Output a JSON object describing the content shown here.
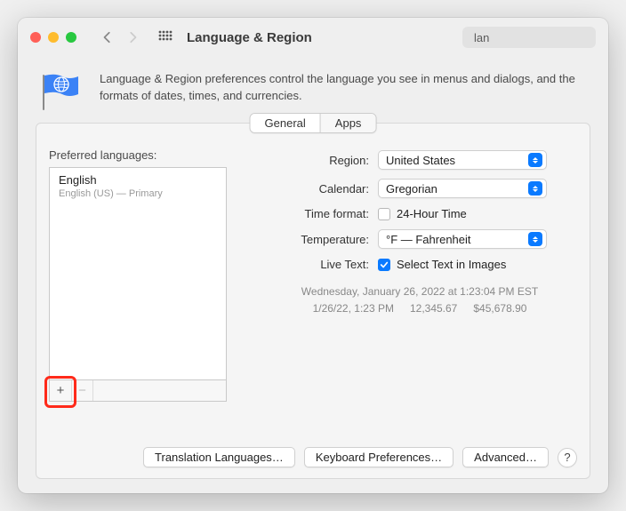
{
  "window": {
    "title": "Language & Region"
  },
  "search": {
    "value": "lan"
  },
  "description": "Language & Region preferences control the language you see in menus and dialogs, and the formats of dates, times, and currencies.",
  "tabs": {
    "general": "General",
    "apps": "Apps"
  },
  "preferred": {
    "label": "Preferred languages:",
    "items": [
      {
        "name": "English",
        "sub": "English (US) — Primary"
      }
    ],
    "add_label": "+",
    "remove_label": "−"
  },
  "form": {
    "region_label": "Region:",
    "region_value": "United States",
    "calendar_label": "Calendar:",
    "calendar_value": "Gregorian",
    "timefmt_label": "Time format:",
    "timefmt_cb": "24-Hour Time",
    "temp_label": "Temperature:",
    "temp_value": "°F — Fahrenheit",
    "livetext_label": "Live Text:",
    "livetext_cb": "Select Text in Images"
  },
  "sample": {
    "line1": "Wednesday, January 26, 2022 at 1:23:04 PM EST",
    "date_short": "1/26/22, 1:23 PM",
    "number": "12,345.67",
    "currency": "$45,678.90"
  },
  "buttons": {
    "translation": "Translation Languages…",
    "keyboard": "Keyboard Preferences…",
    "advanced": "Advanced…",
    "help": "?"
  }
}
